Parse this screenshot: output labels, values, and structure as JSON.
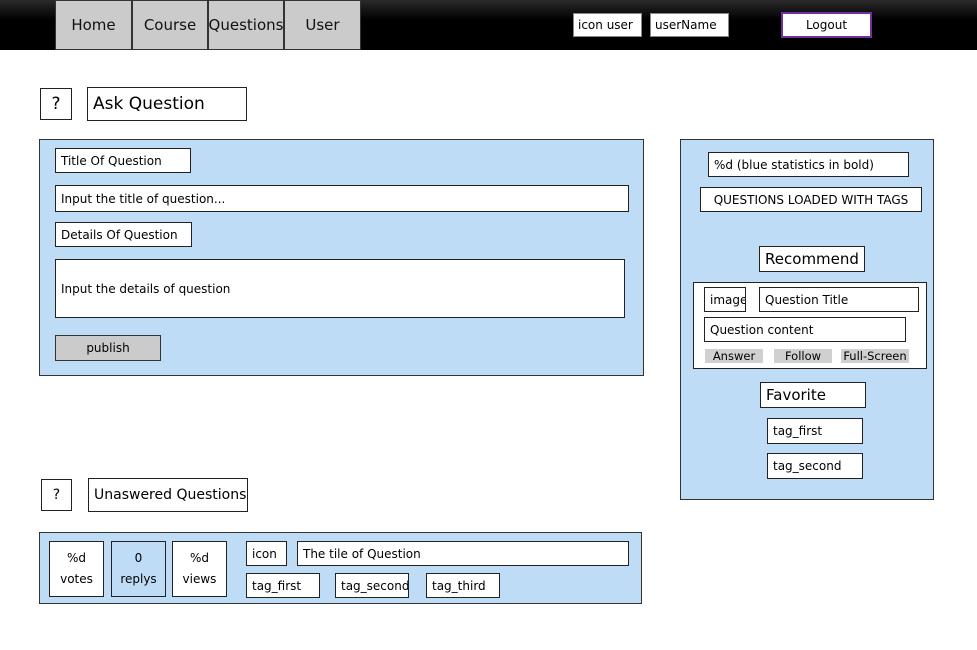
{
  "nav": {
    "tabs": [
      "Home",
      "Course",
      "Questions",
      "User"
    ],
    "icon_user": "icon user",
    "username": "userName",
    "logout": "Logout"
  },
  "ask": {
    "icon": "?",
    "title": "Ask Question",
    "title_label": "Title Of Question",
    "title_placeholder": "Input the title of question...",
    "details_label": "Details Of Question",
    "details_placeholder": "Input the details of question",
    "publish": "publish"
  },
  "sidebar": {
    "stats": "%d (blue statistics in bold)",
    "loaded_with_tags": "QUESTIONS LOADED WITH TAGS",
    "recommend_title": "Recommend",
    "recommend_card": {
      "image": "image",
      "question_title": "Question Title",
      "question_content": "Question content",
      "answer": "Answer",
      "follow": "Follow",
      "fullscreen": "Full-Screen"
    },
    "favorite_title": "Favorite",
    "favorite_tags": [
      "tag_first",
      "tag_second"
    ]
  },
  "unanswered": {
    "icon": "?",
    "title": "Unaswered Questions",
    "item": {
      "votes_value": "%d",
      "votes_label": "votes",
      "replies_value": "0",
      "replies_label": "replys",
      "views_value": "%d",
      "views_label": "views",
      "icon": "icon",
      "question_title": "The tile of Question",
      "tags": [
        "tag_first",
        "tag_second",
        "tag_third"
      ]
    }
  }
}
